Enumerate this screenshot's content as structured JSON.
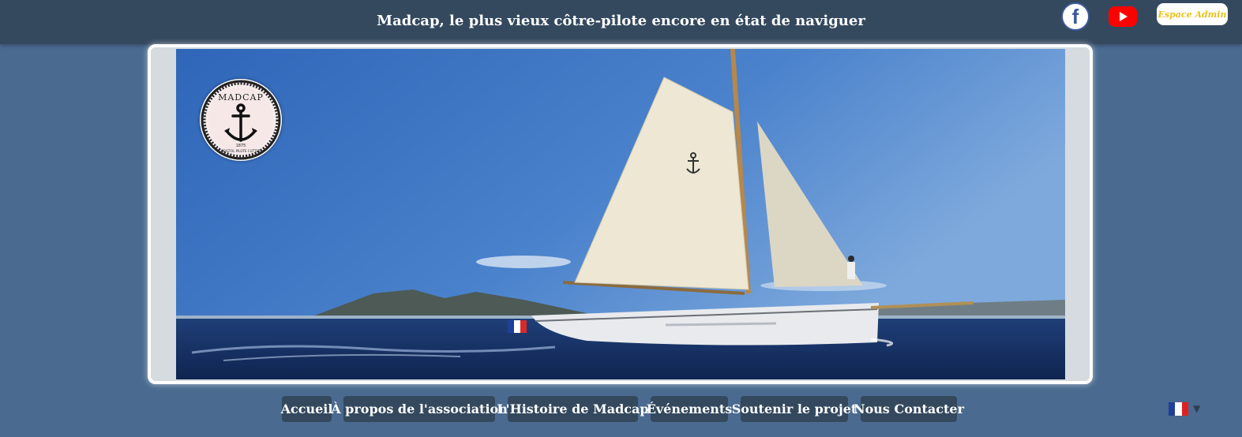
{
  "header": {
    "title": "Madcap, le plus vieux côtre-pilote encore en état de naviguer",
    "facebook_glyph": "f",
    "admin_label": "Espace Admin"
  },
  "logo": {
    "arc_text": "MADCAP",
    "year": "1875",
    "bottom_text": "BRISTOL PILOTE CUTTER"
  },
  "nav": {
    "items": [
      {
        "label": "Accueil"
      },
      {
        "label": "À propos de l'association"
      },
      {
        "label": "L'Histoire de Madcap"
      },
      {
        "label": "Événements"
      },
      {
        "label": "Soutenir le projet"
      },
      {
        "label": "Nous Contacter"
      }
    ]
  },
  "language": {
    "selected": "fr",
    "caret": "▼"
  },
  "colors": {
    "background": "#4a6a8f",
    "header": "#34495e",
    "facebook": "#3b5998",
    "youtube": "#ff0000",
    "admin_text": "#e6c21a"
  },
  "icons": [
    "facebook-icon",
    "youtube-icon",
    "anchor-icon",
    "france-flag-icon",
    "chevron-down-icon"
  ]
}
